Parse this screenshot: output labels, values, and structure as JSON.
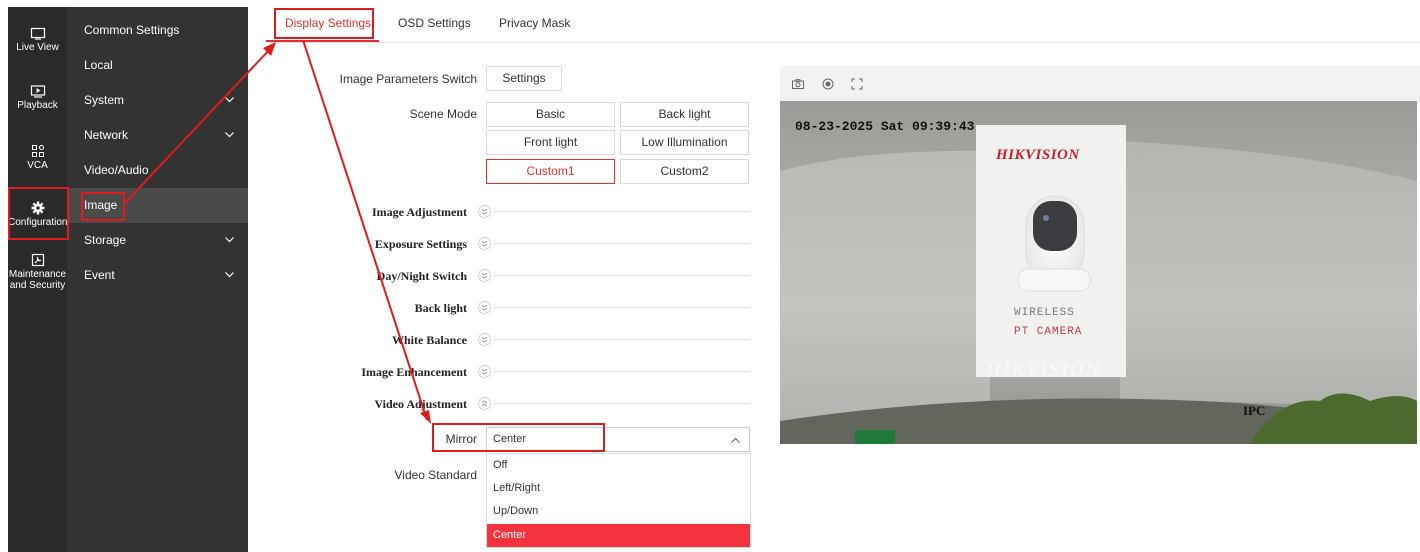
{
  "icon_bar": [
    {
      "label": "Live View",
      "icon": "monitor-icon"
    },
    {
      "label": "Playback",
      "icon": "playback-icon"
    },
    {
      "label": "VCA",
      "icon": "vca-icon"
    },
    {
      "label": "Configuration",
      "icon": "gear-icon"
    },
    {
      "label_line1": "Maintenance",
      "label_line2": "and Security",
      "icon": "maintenance-icon"
    }
  ],
  "sub_menu": [
    {
      "label": "Common Settings"
    },
    {
      "label": "Local"
    },
    {
      "label": "System",
      "expandable": true
    },
    {
      "label": "Network",
      "expandable": true
    },
    {
      "label": "Video/Audio"
    },
    {
      "label": "Image",
      "active": true
    },
    {
      "label": "Storage",
      "expandable": true
    },
    {
      "label": "Event",
      "expandable": true
    }
  ],
  "tabs": [
    "Display Settings",
    "OSD Settings",
    "Privacy Mask"
  ],
  "form": {
    "image_params_label": "Image Parameters Switch",
    "settings_button": "Settings",
    "scene_mode_label": "Scene Mode",
    "scenes": [
      "Basic",
      "Back light",
      "Front light",
      "Low Illumination",
      "Custom1",
      "Custom2"
    ],
    "selected_scene": "Custom1",
    "sections": [
      "Image Adjustment",
      "Exposure Settings",
      "Day/Night Switch",
      "Back light",
      "White Balance",
      "Image Enhancement",
      "Video Adjustment"
    ],
    "mirror_label": "Mirror",
    "mirror_value": "Center",
    "mirror_options": [
      "Off",
      "Left/Right",
      "Up/Down",
      "Center"
    ],
    "video_standard_label": "Video Standard"
  },
  "preview": {
    "osd_timestamp": "08-23-2025 Sat 09:39:43",
    "brand_text": "HIKVISION",
    "box_line1": "WIRELESS",
    "box_line2": "PT CAMERA",
    "ipc_label": "IPC",
    "toolbar_icons": [
      "camera-icon",
      "record-icon",
      "fullscreen-icon"
    ]
  },
  "colors": {
    "accent": "#e03030",
    "selected_option": "#f5333e",
    "sidebar_dark": "#2a2a2a",
    "submenu": "#333333"
  }
}
